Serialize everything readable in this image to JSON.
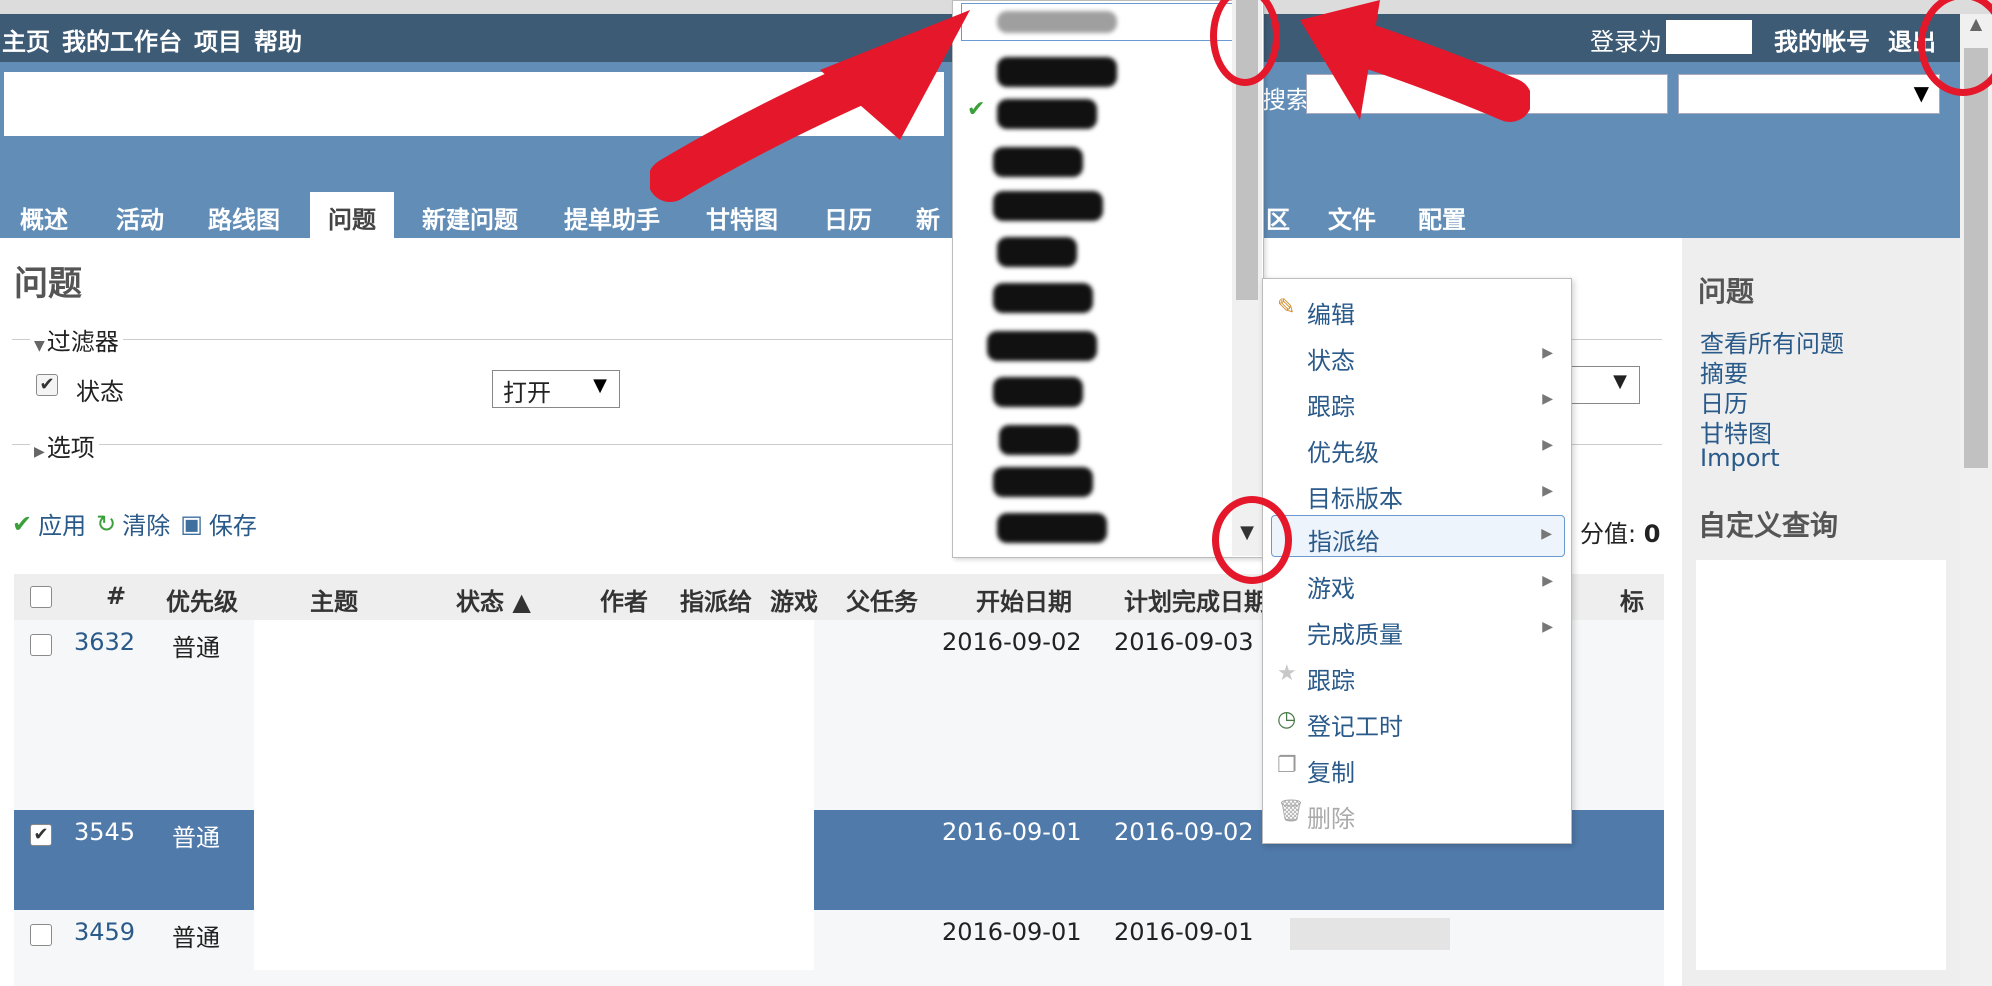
{
  "top_menu": {
    "items": [
      "主页",
      "我的工作台",
      "项目",
      "帮助"
    ],
    "login_as": "登录为",
    "my_account": "我的帐号",
    "logout": "退出"
  },
  "header": {
    "search_label": "搜索",
    "search_value": ""
  },
  "main_menu": {
    "tabs": [
      "概述",
      "活动",
      "路线图",
      "问题",
      "新建问题",
      "提单助手",
      "甘特图",
      "日历",
      "新",
      "区",
      "文件",
      "配置"
    ],
    "selected": "问题"
  },
  "content": {
    "title": "问题",
    "filters_legend": "过滤器",
    "status_label": "状态",
    "status_operator": "打开",
    "options_legend": "选项",
    "apply": "应用",
    "clear": "清除",
    "save": "保存",
    "score_label": "分值:",
    "score_value": "0"
  },
  "table": {
    "headers": [
      "#",
      "优先级",
      "主题",
      "状态 ▲",
      "作者",
      "指派给",
      "游戏",
      "父任务",
      "开始日期",
      "计划完成日期",
      "标签"
    ],
    "rows": [
      {
        "id": "3632",
        "priority": "普通",
        "start": "2016-09-02",
        "due": "2016-09-03",
        "checked": false
      },
      {
        "id": "3545",
        "priority": "普通",
        "start": "2016-09-01",
        "due": "2016-09-02",
        "checked": true
      },
      {
        "id": "3459",
        "priority": "普通",
        "start": "2016-09-01",
        "due": "2016-09-01",
        "checked": false
      }
    ]
  },
  "context_menu": {
    "items": [
      {
        "label": "编辑",
        "icon": "pencil-icon",
        "submenu": false
      },
      {
        "label": "状态",
        "icon": "",
        "submenu": true
      },
      {
        "label": "跟踪",
        "icon": "",
        "submenu": true
      },
      {
        "label": "优先级",
        "icon": "",
        "submenu": true
      },
      {
        "label": "目标版本",
        "icon": "",
        "submenu": true
      },
      {
        "label": "指派给",
        "icon": "",
        "submenu": true
      },
      {
        "label": "游戏",
        "icon": "",
        "submenu": true
      },
      {
        "label": "完成质量",
        "icon": "",
        "submenu": true
      },
      {
        "label": "跟踪",
        "icon": "star-icon",
        "submenu": false
      },
      {
        "label": "登记工时",
        "icon": "clock-icon",
        "submenu": false
      },
      {
        "label": "复制",
        "icon": "copy-icon",
        "submenu": false
      },
      {
        "label": "删除",
        "icon": "trash-icon",
        "submenu": false
      }
    ]
  },
  "sidebar": {
    "title": "问题",
    "links": [
      "查看所有问题",
      "摘要",
      "日历",
      "甘特图",
      "Import"
    ],
    "custom_queries": "自定义查询"
  },
  "colors": {
    "top_bar": "#3e5b76",
    "header": "#628db6",
    "selected_row": "#507aaa",
    "link": "#2a5a8a",
    "annotation": "#e5172a"
  }
}
